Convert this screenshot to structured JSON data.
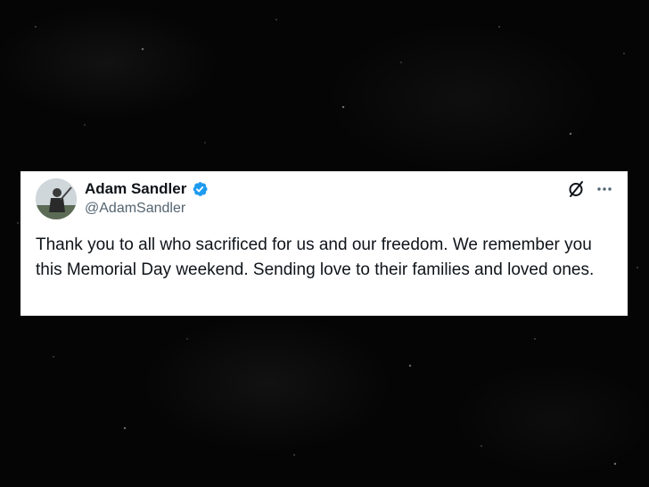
{
  "tweet": {
    "author": {
      "display_name": "Adam Sandler",
      "handle": "@AdamSandler",
      "verified": true,
      "verified_color": "#1d9bf0"
    },
    "text": "Thank you to all who sacrificed for us and our freedom. We remember you this Memorial Day weekend. Sending love to their families and loved ones.",
    "icons": {
      "grok": "grok-icon",
      "more": "more-options-icon"
    }
  },
  "colors": {
    "background": "#050505",
    "card": "#ffffff",
    "primary_text": "#0f1419",
    "secondary_text": "#536471"
  }
}
